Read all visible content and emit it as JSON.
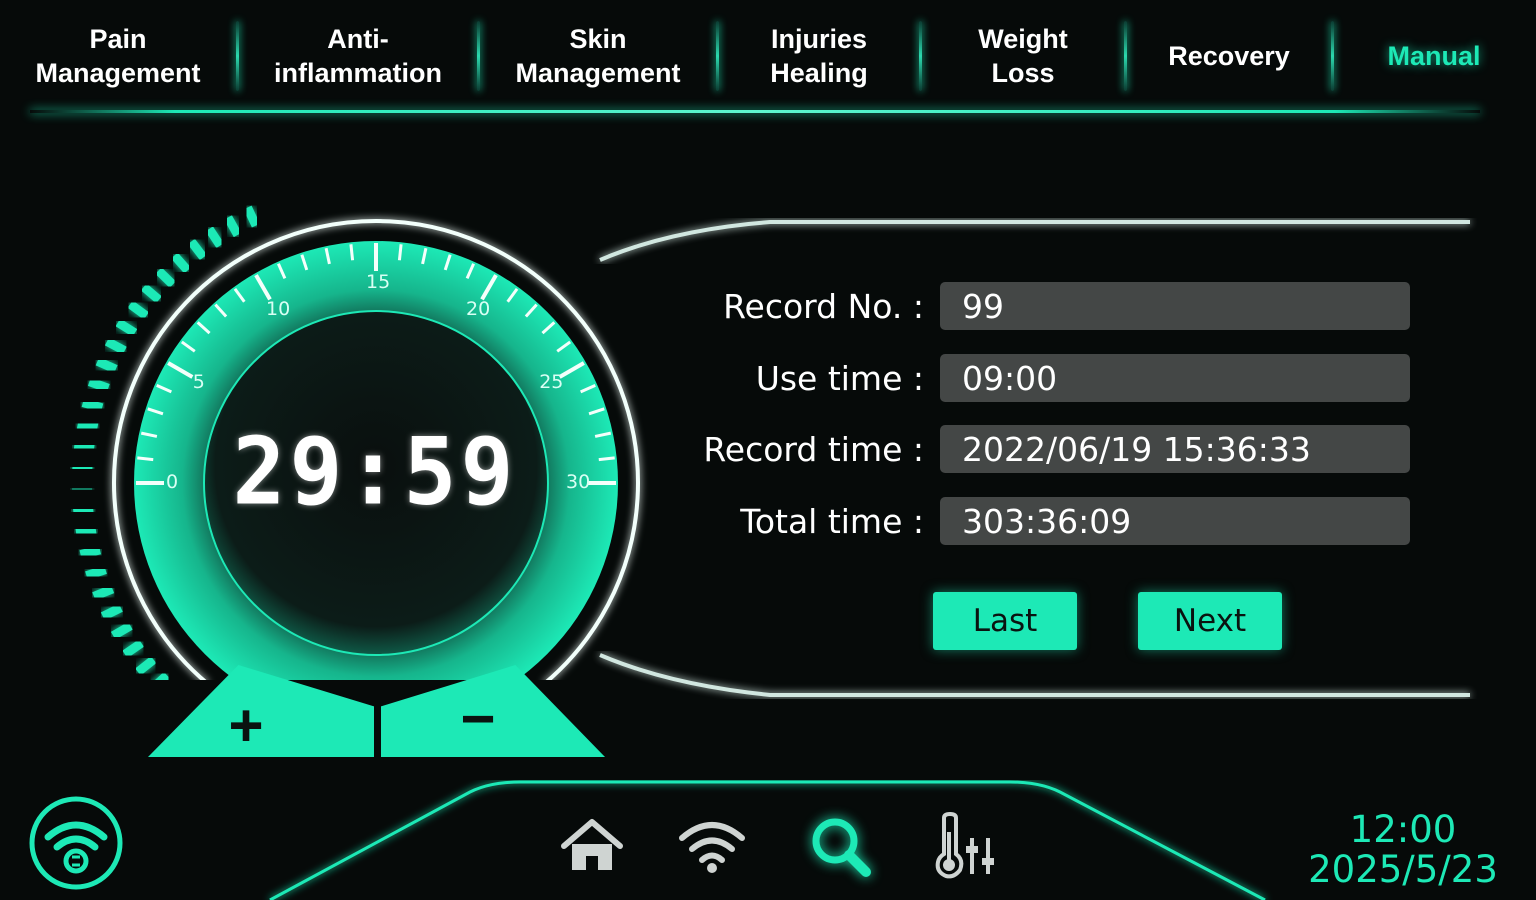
{
  "tabs": [
    {
      "label": "Pain\nManagement",
      "active": false
    },
    {
      "label": "Anti-\ninflammation",
      "active": false
    },
    {
      "label": "Skin\nManagement",
      "active": false
    },
    {
      "label": "Injuries\nHealing",
      "active": false
    },
    {
      "label": "Weight\nLoss",
      "active": false
    },
    {
      "label": "Recovery",
      "active": false
    },
    {
      "label": "Manual",
      "active": true
    }
  ],
  "dial": {
    "timer": "29:59",
    "scale_labels": [
      "0",
      "5",
      "10",
      "15",
      "20",
      "25",
      "30"
    ],
    "scale_max": 30,
    "level_fraction": 1.0
  },
  "controls": {
    "plus": "+",
    "minus": "−"
  },
  "record": {
    "record_no_label": "Record No. :",
    "record_no": "99",
    "use_time_label": "Use time :",
    "use_time": "09:00",
    "record_time_label": "Record time :",
    "record_time": "2022/06/19 15:36:33",
    "total_time_label": "Total time :",
    "total_time": "303:36:09",
    "last_label": "Last",
    "next_label": "Next"
  },
  "bottom": {
    "icons": [
      "wifi-sync-icon",
      "home-icon",
      "wifi-icon",
      "search-icon",
      "thermometer-settings-icon"
    ],
    "time": "12:00",
    "date": "2025/5/23"
  },
  "colors": {
    "accent": "#1de9b6",
    "background": "#060a09",
    "field": "#444746"
  }
}
